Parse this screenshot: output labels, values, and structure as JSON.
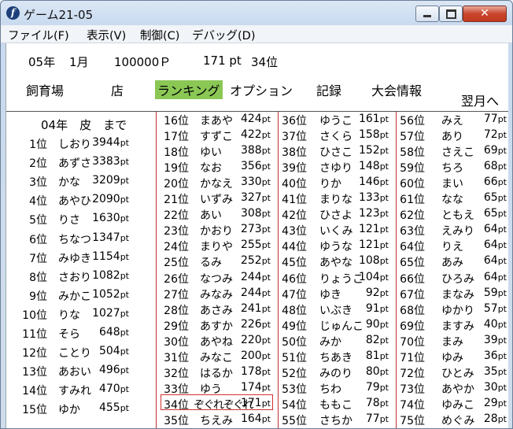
{
  "window": {
    "title": "ゲーム21-05",
    "close_glyph": "✕"
  },
  "menu": [
    "ファイル(F)",
    "表示(V)",
    "制御(C)",
    "デバッグ(D)"
  ],
  "status": {
    "year": "05年",
    "month": "1月",
    "money": "100000Ｐ",
    "points": "171 pt",
    "place": "34位"
  },
  "nav": {
    "tabs": [
      "飼育場",
      "店",
      "ランキング",
      "オプション",
      "記録",
      "大会情報"
    ],
    "active": "ランキング",
    "next_month": "翌月へ"
  },
  "ranking": {
    "first_column_title": "04年　皮　まで",
    "columns": [
      [
        [
          "1位",
          "しおり",
          "3944"
        ],
        [
          "2位",
          "あずさ",
          "3383"
        ],
        [
          "3位",
          "かな",
          "3209"
        ],
        [
          "4位",
          "あやひ",
          "2090"
        ],
        [
          "5位",
          "りさ",
          "1630"
        ],
        [
          "6位",
          "ちなつ",
          "1347"
        ],
        [
          "7位",
          "みゆき",
          "1154"
        ],
        [
          "8位",
          "さおり",
          "1082"
        ],
        [
          "9位",
          "みかこ",
          "1052"
        ],
        [
          "10位",
          "りな",
          "1027"
        ],
        [
          "11位",
          "そら",
          "648"
        ],
        [
          "12位",
          "ことり",
          "504"
        ],
        [
          "13位",
          "あおい",
          "496"
        ],
        [
          "14位",
          "すみれ",
          "470"
        ],
        [
          "15位",
          "ゆか",
          "455"
        ]
      ],
      [
        [
          "16位",
          "まあや",
          "424"
        ],
        [
          "17位",
          "すずこ",
          "422"
        ],
        [
          "18位",
          "ゆい",
          "388"
        ],
        [
          "19位",
          "なお",
          "356"
        ],
        [
          "20位",
          "かなえ",
          "330"
        ],
        [
          "21位",
          "いずみ",
          "327"
        ],
        [
          "22位",
          "あい",
          "308"
        ],
        [
          "23位",
          "かおり",
          "273"
        ],
        [
          "24位",
          "まりや",
          "255"
        ],
        [
          "25位",
          "るみ",
          "252"
        ],
        [
          "26位",
          "なつみ",
          "244"
        ],
        [
          "27位",
          "みなみ",
          "244"
        ],
        [
          "28位",
          "あさみ",
          "241"
        ],
        [
          "29位",
          "あすか",
          "226"
        ],
        [
          "30位",
          "あやね",
          "220"
        ],
        [
          "31位",
          "みなこ",
          "200"
        ],
        [
          "32位",
          "はるか",
          "178"
        ],
        [
          "33位",
          "ゆう",
          "174"
        ],
        [
          "34位",
          "ぞぐれぞぐれ",
          "171"
        ],
        [
          "35位",
          "ちえみ",
          "164"
        ]
      ],
      [
        [
          "36位",
          "ゆうこ",
          "161"
        ],
        [
          "37位",
          "さくら",
          "158"
        ],
        [
          "38位",
          "ひさこ",
          "152"
        ],
        [
          "39位",
          "さゆり",
          "148"
        ],
        [
          "40位",
          "りか",
          "146"
        ],
        [
          "41位",
          "まりな",
          "133"
        ],
        [
          "42位",
          "ひさよ",
          "123"
        ],
        [
          "43位",
          "いくみ",
          "121"
        ],
        [
          "44位",
          "ゆうな",
          "121"
        ],
        [
          "45位",
          "あやな",
          "108"
        ],
        [
          "46位",
          "りょうこ",
          "104"
        ],
        [
          "47位",
          "ゆき",
          "92"
        ],
        [
          "48位",
          "いぶき",
          "91"
        ],
        [
          "49位",
          "じゅんこ",
          "90"
        ],
        [
          "50位",
          "みか",
          "82"
        ],
        [
          "51位",
          "ちあき",
          "81"
        ],
        [
          "52位",
          "みのり",
          "80"
        ],
        [
          "53位",
          "ちわ",
          "79"
        ],
        [
          "54位",
          "ももこ",
          "78"
        ],
        [
          "55位",
          "さちか",
          "77"
        ]
      ],
      [
        [
          "56位",
          "みえ",
          "77"
        ],
        [
          "57位",
          "あり",
          "72"
        ],
        [
          "58位",
          "さえこ",
          "69"
        ],
        [
          "59位",
          "ちろ",
          "68"
        ],
        [
          "60位",
          "まい",
          "66"
        ],
        [
          "61位",
          "なな",
          "65"
        ],
        [
          "62位",
          "ともえ",
          "65"
        ],
        [
          "63位",
          "えみり",
          "64"
        ],
        [
          "64位",
          "りえ",
          "64"
        ],
        [
          "65位",
          "あみ",
          "64"
        ],
        [
          "66位",
          "ひろみ",
          "64"
        ],
        [
          "67位",
          "まなみ",
          "59"
        ],
        [
          "68位",
          "ゆかり",
          "57"
        ],
        [
          "69位",
          "ますみ",
          "40"
        ],
        [
          "70位",
          "まみ",
          "39"
        ],
        [
          "71位",
          "ゆみ",
          "36"
        ],
        [
          "72位",
          "ひとみ",
          "35"
        ],
        [
          "73位",
          "あやか",
          "30"
        ],
        [
          "74位",
          "ゆみこ",
          "29"
        ],
        [
          "75位",
          "めぐみ",
          "28"
        ]
      ]
    ],
    "unit": "pt",
    "highlight_rank": "34位"
  },
  "colors": {
    "active_tab": "#8ac755",
    "highlight_border": "#d23030",
    "divider": "#c03030"
  }
}
